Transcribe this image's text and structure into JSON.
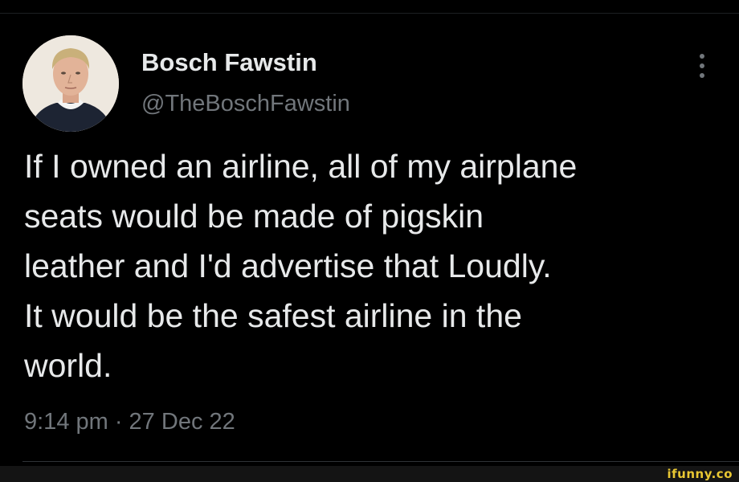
{
  "author": {
    "display_name": "Bosch Fawstin",
    "handle": "@TheBoschFawstin"
  },
  "tweet": {
    "text": "If I owned an airline, all of my airplane\nseats would be made of pigskin\nleather and I'd advertise that Loudly.\nIt would be the safest airline in the\nworld.",
    "timestamp": "9:14 pm · 27 Dec 22"
  },
  "icons": {
    "more": "vertical-ellipsis-icon",
    "avatar": "profile-photo"
  },
  "watermark": {
    "text": "ifunny.co"
  },
  "colors": {
    "background": "#000000",
    "primary_text": "#e7e9ea",
    "secondary_text": "#71767b",
    "watermark": "#e8c733"
  }
}
